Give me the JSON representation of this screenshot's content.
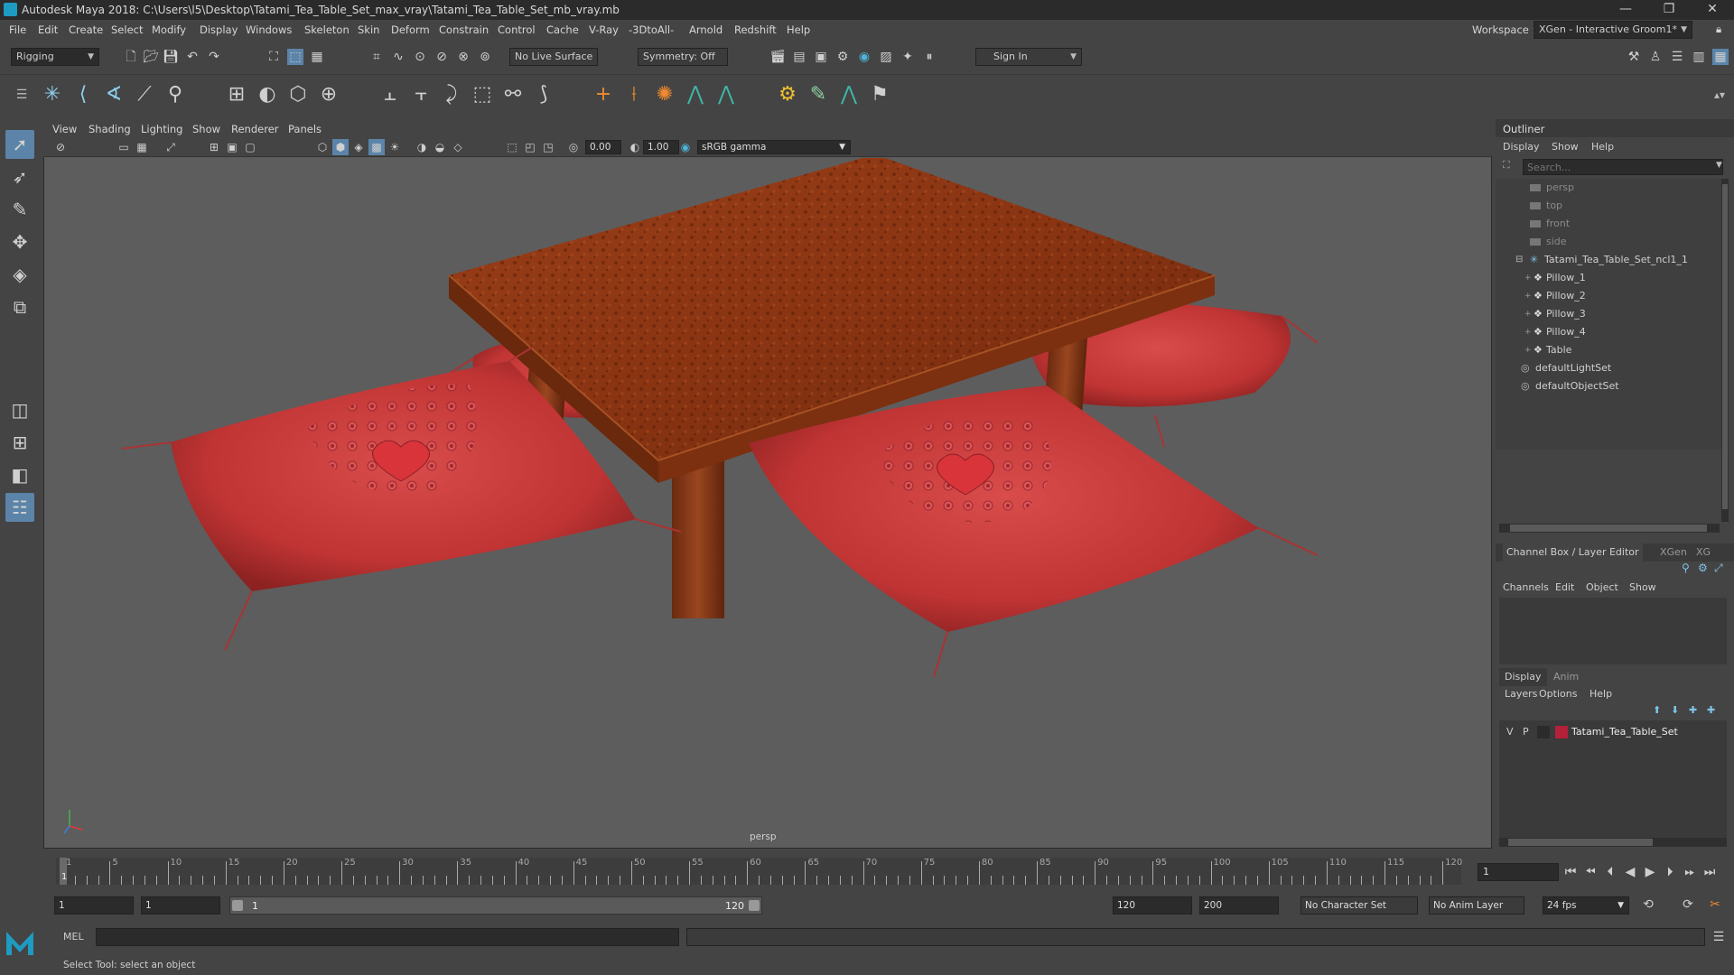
{
  "window": {
    "title": "Autodesk Maya 2018: C:\\Users\\l5\\Desktop\\Tatami_Tea_Table_Set_max_vray\\Tatami_Tea_Table_Set_mb_vray.mb",
    "workspace_label": "Workspace :",
    "workspace_value": "XGen - Interactive Groom1*"
  },
  "menubar": [
    "File",
    "Edit",
    "Create",
    "Select",
    "Modify",
    "Display",
    "Windows",
    "Skeleton",
    "Skin",
    "Deform",
    "Constrain",
    "Control",
    "Cache",
    "V-Ray",
    "-3DtoAll-",
    "Arnold",
    "Redshift",
    "Help"
  ],
  "statusline": {
    "mode": "Rigging",
    "live_surface": "No Live Surface",
    "symmetry": "Symmetry: Off",
    "sign_in": "Sign In"
  },
  "viewport": {
    "menu": [
      "View",
      "Shading",
      "Lighting",
      "Show",
      "Renderer",
      "Panels"
    ],
    "exposure": "0.00",
    "gamma": "1.00",
    "color_space": "sRGB gamma",
    "camera_label": "persp"
  },
  "outliner": {
    "title": "Outliner",
    "menu": [
      "Display",
      "Show",
      "Help"
    ],
    "search_placeholder": "Search...",
    "items": [
      {
        "label": "persp",
        "type": "camera",
        "dim": true,
        "indent": 0
      },
      {
        "label": "top",
        "type": "camera",
        "dim": true,
        "indent": 0
      },
      {
        "label": "front",
        "type": "camera",
        "dim": true,
        "indent": 0
      },
      {
        "label": "side",
        "type": "camera",
        "dim": true,
        "indent": 0
      },
      {
        "label": "Tatami_Tea_Table_Set_ncl1_1",
        "type": "group",
        "dim": false,
        "indent": 0
      },
      {
        "label": "Pillow_1",
        "type": "mesh",
        "dim": false,
        "indent": 1
      },
      {
        "label": "Pillow_2",
        "type": "mesh",
        "dim": false,
        "indent": 1
      },
      {
        "label": "Pillow_3",
        "type": "mesh",
        "dim": false,
        "indent": 1
      },
      {
        "label": "Pillow_4",
        "type": "mesh",
        "dim": false,
        "indent": 1
      },
      {
        "label": "Table",
        "type": "mesh",
        "dim": false,
        "indent": 1
      },
      {
        "label": "defaultLightSet",
        "type": "set",
        "dim": false,
        "indent": 0
      },
      {
        "label": "defaultObjectSet",
        "type": "set",
        "dim": false,
        "indent": 0
      }
    ]
  },
  "channelbox": {
    "tabs": [
      "Channel Box / Layer Editor",
      "XGen",
      "XG"
    ],
    "menu": [
      "Channels",
      "Edit",
      "Object",
      "Show"
    ]
  },
  "layer_editor": {
    "tabs": [
      "Display",
      "Anim"
    ],
    "menu": [
      "Layers",
      "Options",
      "Help"
    ],
    "layer": {
      "v": "V",
      "p": "P",
      "name": "Tatami_Tea_Table_Set",
      "color": "#b3203a"
    }
  },
  "timeline": {
    "ticks": [
      1,
      5,
      10,
      15,
      20,
      25,
      30,
      35,
      40,
      45,
      50,
      55,
      60,
      65,
      70,
      75,
      80,
      85,
      90,
      95,
      100,
      105,
      110,
      115,
      120
    ],
    "current_frame": "1",
    "start_label": "1"
  },
  "range": {
    "start": "1",
    "playback_start": "1",
    "slider_start": "1",
    "slider_end": "120",
    "playback_end": "120",
    "end": "200",
    "character_set": "No Character Set",
    "anim_layer": "No Anim Layer",
    "fps": "24 fps"
  },
  "cmdline": {
    "label": "MEL",
    "help": "Select Tool: select an object"
  },
  "colors": {
    "accent": "#5b84a8",
    "maya_logo": "#1e9bc2",
    "pillow": "#c33a3a",
    "table": "#8a3a14"
  }
}
